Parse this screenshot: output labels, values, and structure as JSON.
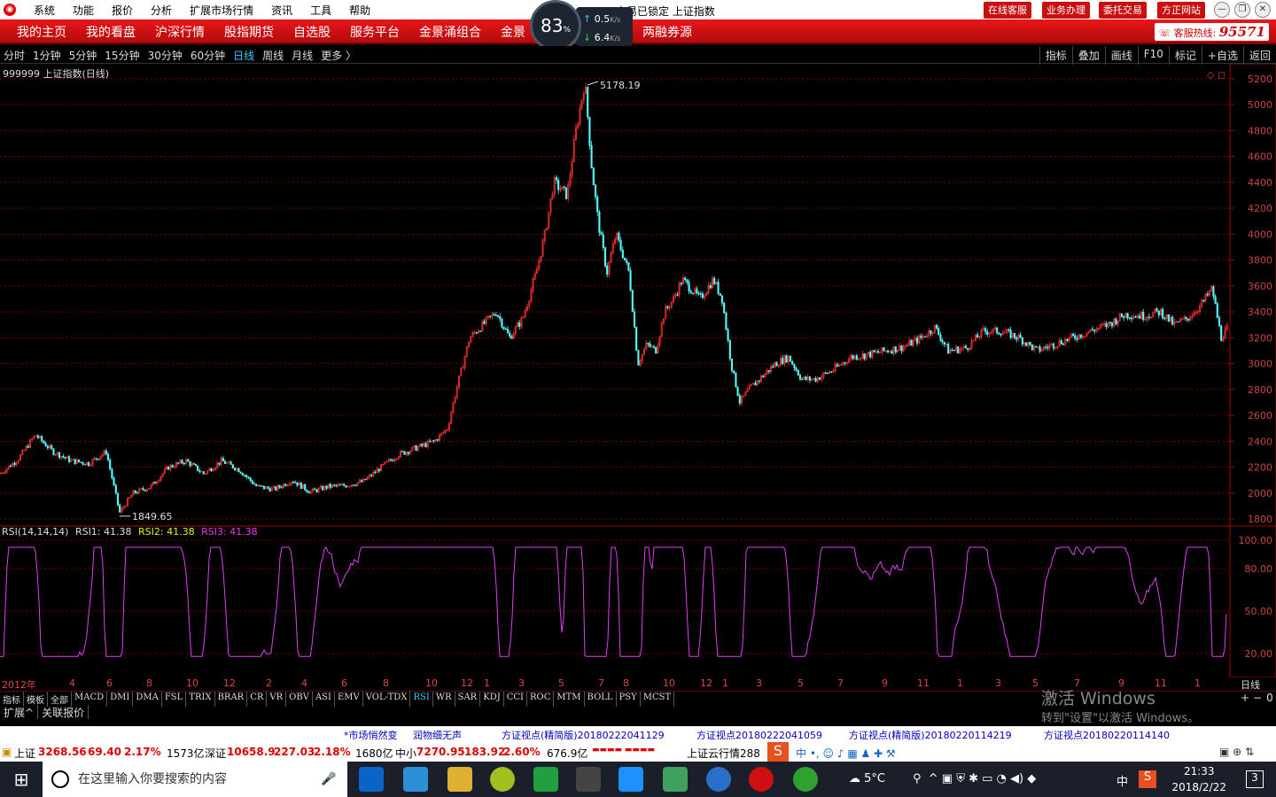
{
  "titlebar": {
    "menu": [
      "系统",
      "功能",
      "报价",
      "分析",
      "扩展市场行情",
      "资讯",
      "工具",
      "帮助"
    ],
    "title": "交易已锁定   上证指数",
    "buttons": [
      "在线客服",
      "业务办理",
      "委托交易",
      "方正网站"
    ]
  },
  "speed": {
    "percent": "83",
    "percent_unit": "%",
    "up": "0.5",
    "down": "6.4",
    "unit": "K/s"
  },
  "nav": {
    "items": [
      "我的主页",
      "我的看盘",
      "沪深行情",
      "股指期货",
      "自选股",
      "服务平台",
      "金景涌组合",
      "金景",
      "",
      "两融券源"
    ],
    "hotline_label": "客服热线:",
    "hotline_number": "95571"
  },
  "periods": {
    "items": [
      "分时",
      "1分钟",
      "5分钟",
      "15分钟",
      "30分钟",
      "60分钟",
      "日线",
      "周线",
      "月线",
      "更多 〉"
    ],
    "active": "日线"
  },
  "toolbar_right": [
    "指标",
    "叠加",
    "画线",
    "F10",
    "标记",
    "+自选",
    "返回"
  ],
  "chart_title": "999999 上证指数(日线)",
  "chart_data": {
    "type": "candlestick",
    "price_axis": [
      5200,
      5000,
      4800,
      4600,
      4400,
      4200,
      4000,
      3800,
      3600,
      3400,
      3200,
      3000,
      2800,
      2600,
      2400,
      2200,
      2000,
      1800
    ],
    "ylim": [
      1760,
      5260
    ],
    "high_label": "5178.19",
    "low_label": "1849.65",
    "close_path": [
      [
        0,
        2150
      ],
      [
        20,
        2260
      ],
      [
        40,
        2450
      ],
      [
        60,
        2320
      ],
      [
        80,
        2250
      ],
      [
        100,
        2230
      ],
      [
        120,
        2320
      ],
      [
        135,
        1850
      ],
      [
        150,
        2000
      ],
      [
        170,
        2050
      ],
      [
        190,
        2200
      ],
      [
        210,
        2250
      ],
      [
        230,
        2150
      ],
      [
        250,
        2250
      ],
      [
        270,
        2180
      ],
      [
        290,
        2050
      ],
      [
        310,
        2030
      ],
      [
        330,
        2100
      ],
      [
        350,
        2010
      ],
      [
        370,
        2050
      ],
      [
        390,
        2060
      ],
      [
        410,
        2090
      ],
      [
        430,
        2200
      ],
      [
        450,
        2300
      ],
      [
        470,
        2350
      ],
      [
        490,
        2400
      ],
      [
        505,
        2500
      ],
      [
        515,
        2800
      ],
      [
        530,
        3200
      ],
      [
        545,
        3300
      ],
      [
        560,
        3400
      ],
      [
        575,
        3200
      ],
      [
        590,
        3350
      ],
      [
        605,
        3700
      ],
      [
        615,
        4000
      ],
      [
        625,
        4400
      ],
      [
        640,
        4300
      ],
      [
        650,
        4800
      ],
      [
        660,
        5178
      ],
      [
        668,
        4500
      ],
      [
        675,
        4100
      ],
      [
        685,
        3700
      ],
      [
        695,
        4000
      ],
      [
        710,
        3700
      ],
      [
        720,
        3000
      ],
      [
        730,
        3150
      ],
      [
        740,
        3100
      ],
      [
        750,
        3400
      ],
      [
        760,
        3500
      ],
      [
        770,
        3650
      ],
      [
        790,
        3500
      ],
      [
        805,
        3650
      ],
      [
        815,
        3500
      ],
      [
        825,
        3000
      ],
      [
        835,
        2700
      ],
      [
        845,
        2800
      ],
      [
        860,
        2900
      ],
      [
        875,
        3000
      ],
      [
        890,
        3050
      ],
      [
        905,
        2880
      ],
      [
        920,
        2880
      ],
      [
        940,
        2950
      ],
      [
        960,
        3050
      ],
      [
        980,
        3070
      ],
      [
        1000,
        3100
      ],
      [
        1020,
        3130
      ],
      [
        1040,
        3200
      ],
      [
        1055,
        3280
      ],
      [
        1070,
        3100
      ],
      [
        1090,
        3120
      ],
      [
        1110,
        3250
      ],
      [
        1130,
        3250
      ],
      [
        1150,
        3200
      ],
      [
        1170,
        3100
      ],
      [
        1190,
        3150
      ],
      [
        1210,
        3200
      ],
      [
        1230,
        3250
      ],
      [
        1250,
        3300
      ],
      [
        1270,
        3380
      ],
      [
        1290,
        3370
      ],
      [
        1310,
        3400
      ],
      [
        1325,
        3300
      ],
      [
        1340,
        3350
      ],
      [
        1355,
        3450
      ],
      [
        1368,
        3580
      ],
      [
        1378,
        3200
      ],
      [
        1385,
        3268
      ]
    ],
    "rsi": {
      "label": "RSI(14,14,14)",
      "rsi1_label": "RSI1:",
      "rsi1": "41.38",
      "rsi2_label": "RSI2:",
      "rsi2": "41.38",
      "rsi3_label": "RSI3:",
      "rsi3": "41.38",
      "axis": [
        "100.00",
        "80.00",
        "50.00",
        "20.00"
      ]
    }
  },
  "date_axis": [
    "2012年",
    "4",
    "6",
    "8",
    "10",
    "12",
    "2",
    "4",
    "6",
    "8",
    "10",
    "12",
    "1",
    "3",
    "5",
    "7",
    "8",
    "10",
    "12",
    "1",
    "3",
    "5",
    "7",
    "9",
    "11",
    "1",
    "3",
    "5",
    "7",
    "9",
    "11",
    "1",
    "3",
    "5",
    "2012年",
    "7",
    "9",
    "11",
    "1"
  ],
  "date_labels": [
    [
      "2012年",
      2
    ],
    [
      "4",
      78
    ],
    [
      "6",
      120
    ],
    [
      "8",
      165
    ],
    [
      "10",
      210
    ],
    [
      "12",
      252
    ],
    [
      "2",
      300
    ],
    [
      "4",
      340
    ],
    [
      "6",
      385
    ],
    [
      "8",
      432
    ],
    [
      "10",
      480
    ],
    [
      "12",
      520
    ],
    [
      "1",
      546
    ],
    [
      "3",
      585
    ],
    [
      "5",
      630
    ],
    [
      "7",
      675
    ],
    [
      "8",
      703
    ],
    [
      "10",
      748
    ],
    [
      "12",
      790
    ],
    [
      "1",
      815
    ],
    [
      "3",
      853
    ],
    [
      "5",
      900
    ],
    [
      "7",
      945
    ],
    [
      "9",
      995
    ],
    [
      "11",
      1035
    ],
    [
      "1",
      1080
    ],
    [
      "3",
      1123
    ],
    [
      "5",
      1165
    ],
    [
      "7",
      1212
    ],
    [
      "9",
      1262
    ],
    [
      "11",
      1303
    ],
    [
      "1",
      1348
    ]
  ],
  "date_right": "日线",
  "indicator_tabs": [
    "指标",
    "模板",
    "全部",
    "MACD",
    "DMI",
    "DMA",
    "FSL",
    "TRIX",
    "BRAR",
    "CR",
    "VR",
    "OBV",
    "ASI",
    "EMV",
    "VOL-TDX",
    "RSI",
    "WR",
    "SAR",
    "KDJ",
    "CCI",
    "ROC",
    "MTM",
    "BOLL",
    "PSY",
    "MCST"
  ],
  "indicator_active": "RSI",
  "extra_tabs": [
    "扩展^",
    "关联报价"
  ],
  "watermark": {
    "line1": "激活 Windows",
    "line2": "转到\"设置\"以激活 Windows。"
  },
  "news": [
    "*市场悄然变",
    "润物细无声",
    "方证视点(精简版)20180222041129",
    "方证视点20180222041059",
    "方证视点(精简版)20180220114219",
    "方证视点20180220114140"
  ],
  "status": {
    "sh_label": "上证",
    "sh_value": "3268.56",
    "sh_change": "69.40",
    "sh_pct": "2.17%",
    "sh_amount": "1573亿",
    "sz_label": "深证",
    "sz_value": "10658.9",
    "sz_change": "227.03",
    "sz_pct": "2.18%",
    "sz_amount": "1680亿",
    "zx_label": "中小",
    "zx_value": "7270.95",
    "zx_change": "183.92",
    "zx_pct": "2.60%",
    "zx_amount": "676.9亿",
    "cloud": "上证云行情288"
  },
  "taskbar": {
    "search_placeholder": "在这里输入你要搜索的内容",
    "weather": "5°C",
    "ime": "中",
    "time": "21:33",
    "date": "2018/2/22",
    "notif": "3"
  }
}
